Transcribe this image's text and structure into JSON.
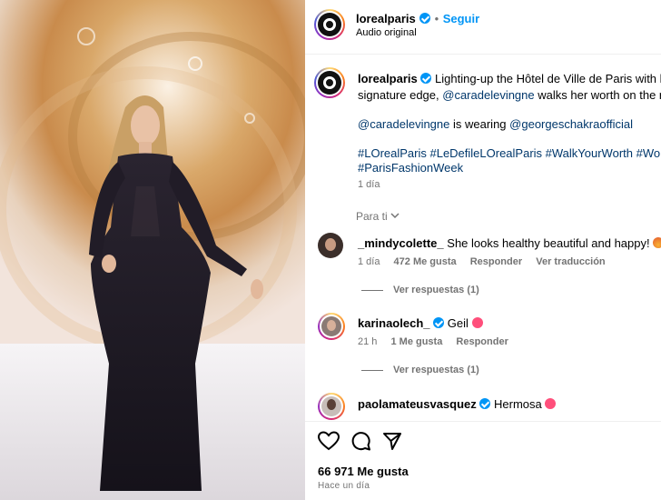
{
  "post": {
    "account": "lorealparis",
    "follow_label": "Seguir",
    "audio": "Audio original"
  },
  "caption": {
    "username": "lorealparis",
    "text_1": "Lighting-up the Hôtel de Ville de Paris with her",
    "text_2": "signature edge,",
    "mention_1": "@caradelevingne",
    "text_3": "walks her worth on the runw",
    "mention_2": "@caradelevingne",
    "text_4": "is wearing",
    "mention_3": "@georgeschakraofficial",
    "hashtags_1": "#LOrealParis #LeDefileLOrealParis #WalkYourWorth #WorthIt",
    "hashtags_2": "#ParisFashionWeek",
    "time": "1 día",
    "para_ti": "Para ti"
  },
  "comments": [
    {
      "user": "_mindycolette_",
      "text": "She looks healthy beautiful and happy!",
      "time": "1 día",
      "likes": "472 Me gusta",
      "reply": "Responder",
      "translate": "Ver traducción",
      "replies": "Ver respuestas (1)"
    },
    {
      "user": "karinaolech_",
      "text": "Geil",
      "time": "21 h",
      "likes": "1 Me gusta",
      "reply": "Responder",
      "replies": "Ver respuestas (1)"
    },
    {
      "user": "paolamateusvasquez",
      "text": "Hermosa"
    }
  ],
  "footer": {
    "likes": "66 971 Me gusta",
    "time": "Hace un día"
  }
}
